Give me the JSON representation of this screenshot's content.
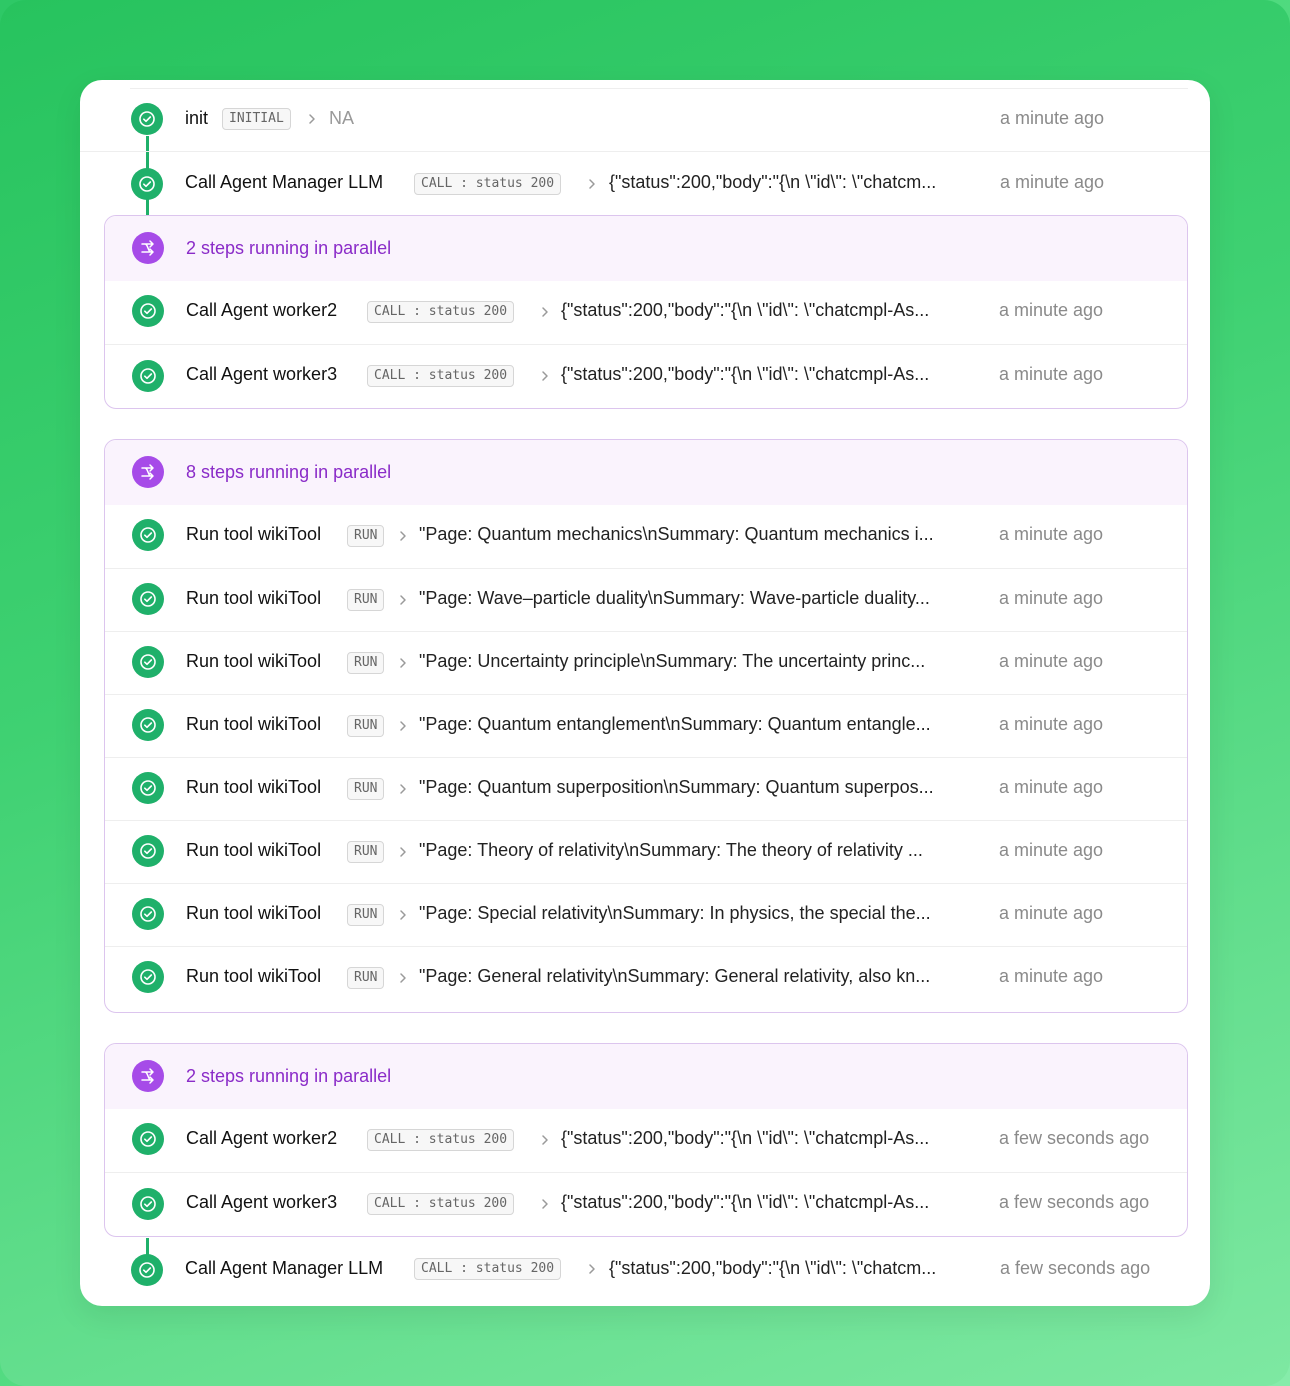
{
  "colors": {
    "success": "#1fb06a",
    "parallel_accent": "#a64be8",
    "parallel_text": "#8a2bc8",
    "parallel_bg": "#faf3fd"
  },
  "icons": {
    "step_status": "check-circle-icon",
    "parallel": "parallel-arrows-icon",
    "chevron": "chevron-right-icon"
  },
  "steps_top": [
    {
      "title": "init",
      "badge": "INITIAL",
      "output": "NA",
      "time": "a minute ago"
    },
    {
      "title": "Call Agent Manager LLM",
      "badge": "CALL : status 200",
      "output": "{\"status\":200,\"body\":\"{\\n \\\"id\\\": \\\"chatcm...",
      "time": "a minute ago"
    }
  ],
  "groups": [
    {
      "label": "2 steps running in parallel",
      "steps": [
        {
          "title": "Call Agent worker2",
          "badge": "CALL : status 200",
          "output": "{\"status\":200,\"body\":\"{\\n \\\"id\\\": \\\"chatcmpl-As...",
          "time": "a minute ago"
        },
        {
          "title": "Call Agent worker3",
          "badge": "CALL : status 200",
          "output": "{\"status\":200,\"body\":\"{\\n \\\"id\\\": \\\"chatcmpl-As...",
          "time": "a minute ago"
        }
      ]
    },
    {
      "label": "8 steps running in parallel",
      "steps": [
        {
          "title": "Run tool wikiTool",
          "badge": "RUN",
          "output": "\"Page: Quantum mechanics\\nSummary: Quantum mechanics i...",
          "time": "a minute ago"
        },
        {
          "title": "Run tool wikiTool",
          "badge": "RUN",
          "output": "\"Page: Wave–particle duality\\nSummary: Wave-particle duality...",
          "time": "a minute ago"
        },
        {
          "title": "Run tool wikiTool",
          "badge": "RUN",
          "output": "\"Page: Uncertainty principle\\nSummary: The uncertainty princ...",
          "time": "a minute ago"
        },
        {
          "title": "Run tool wikiTool",
          "badge": "RUN",
          "output": "\"Page: Quantum entanglement\\nSummary: Quantum entangle...",
          "time": "a minute ago"
        },
        {
          "title": "Run tool wikiTool",
          "badge": "RUN",
          "output": "\"Page: Quantum superposition\\nSummary: Quantum superpos...",
          "time": "a minute ago"
        },
        {
          "title": "Run tool wikiTool",
          "badge": "RUN",
          "output": "\"Page: Theory of relativity\\nSummary: The theory of relativity ...",
          "time": "a minute ago"
        },
        {
          "title": "Run tool wikiTool",
          "badge": "RUN",
          "output": "\"Page: Special relativity\\nSummary: In physics, the special the...",
          "time": "a minute ago"
        },
        {
          "title": "Run tool wikiTool",
          "badge": "RUN",
          "output": "\"Page: General relativity\\nSummary: General relativity, also kn...",
          "time": "a minute ago"
        }
      ]
    },
    {
      "label": "2 steps running in parallel",
      "steps": [
        {
          "title": "Call Agent worker2",
          "badge": "CALL : status 200",
          "output": "{\"status\":200,\"body\":\"{\\n \\\"id\\\": \\\"chatcmpl-As...",
          "time": "a few seconds ago"
        },
        {
          "title": "Call Agent worker3",
          "badge": "CALL : status 200",
          "output": "{\"status\":200,\"body\":\"{\\n \\\"id\\\": \\\"chatcmpl-As...",
          "time": "a few seconds ago"
        }
      ]
    }
  ],
  "steps_bottom": [
    {
      "title": "Call Agent Manager LLM",
      "badge": "CALL : status 200",
      "output": "{\"status\":200,\"body\":\"{\\n \\\"id\\\": \\\"chatcm...",
      "time": "a few seconds ago"
    }
  ]
}
